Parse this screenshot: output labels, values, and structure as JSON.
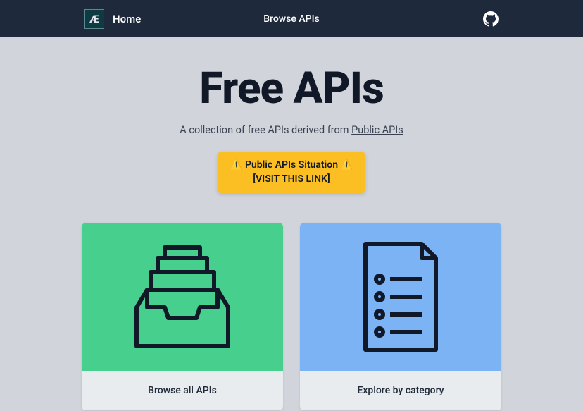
{
  "nav": {
    "logo_text": "Æ",
    "home": "Home",
    "browse": "Browse APIs"
  },
  "hero": {
    "title": "Free APIs",
    "subtitle_prefix": "A collection of free APIs derived from ",
    "subtitle_link": "Public APIs"
  },
  "alert": {
    "line1": "⚠️ Public APIs Situation ⚠️",
    "line2": "[VISIT THIS LINK]"
  },
  "cards": {
    "browse_all": "Browse all APIs",
    "by_category": "Explore by category"
  }
}
